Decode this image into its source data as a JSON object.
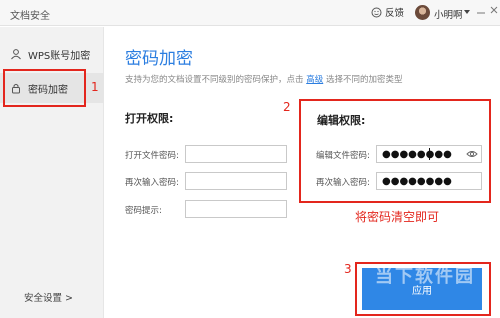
{
  "window": {
    "title": "文档安全"
  },
  "header": {
    "feedback_label": "反馈",
    "username": "小明啊"
  },
  "sidebar": {
    "items": [
      {
        "label": "WPS账号加密"
      },
      {
        "label": "密码加密"
      }
    ],
    "footer_label": "安全设置 >"
  },
  "main": {
    "title": "密码加密",
    "desc_prefix": "支持为您的文档设置不同级别的密码保护，点击",
    "desc_link": "高级",
    "desc_suffix": "选择不同的加密类型",
    "open": {
      "heading": "打开权限:",
      "open_pwd_label": "打开文件密码:",
      "reenter_label": "再次输入密码:",
      "hint_label": "密码提示:"
    },
    "edit": {
      "heading": "编辑权限:",
      "edit_pwd_label": "编辑文件密码:",
      "edit_pwd_value": "●●●●●●●●",
      "reenter_label": "再次输入密码:",
      "reenter_value": "●●●●●●●●"
    },
    "apply_label": "应用"
  },
  "annotations": {
    "n1": "1",
    "n2": "2",
    "n3": "3",
    "note": "将密码清空即可"
  },
  "watermark": "当下软件园",
  "colors": {
    "accent": "#2c7ee0",
    "annotation": "#e3261d",
    "apply_bg": "#2f87e6"
  }
}
